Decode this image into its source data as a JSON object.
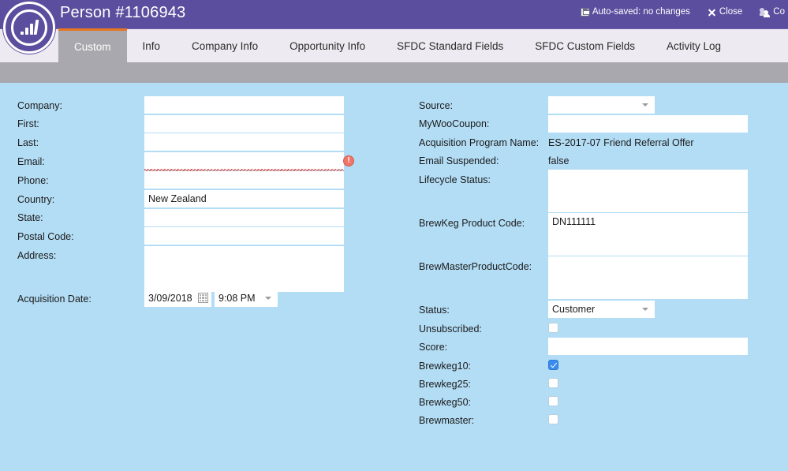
{
  "header": {
    "title": "Person #1106943",
    "logo_name": "marketo-logo",
    "actions": [
      {
        "label": "Auto-saved: no changes",
        "icon": "save-icon"
      },
      {
        "label": "Close",
        "icon": "close-icon"
      },
      {
        "label": "Co",
        "icon": "people-icon"
      }
    ]
  },
  "tabs": [
    {
      "label": "Custom",
      "active": true
    },
    {
      "label": "Info",
      "active": false
    },
    {
      "label": "Company Info",
      "active": false
    },
    {
      "label": "Opportunity Info",
      "active": false
    },
    {
      "label": "SFDC Standard Fields",
      "active": false
    },
    {
      "label": "SFDC Custom Fields",
      "active": false
    },
    {
      "label": "Activity Log",
      "active": false
    }
  ],
  "form": {
    "left": {
      "company_label": "Company:",
      "company_value": "",
      "first_label": "First:",
      "first_value": "",
      "last_label": "Last:",
      "last_value": "",
      "email_label": "Email:",
      "email_value": "",
      "email_error_glyph": "!",
      "phone_label": "Phone:",
      "phone_value": "",
      "country_label": "Country:",
      "country_value": "New Zealand",
      "state_label": "State:",
      "state_value": "",
      "postal_label": "Postal Code:",
      "postal_value": "",
      "address_label": "Address:",
      "address_value": "",
      "acquisition_date_label": "Acquisition Date:",
      "acquisition_date_value": "3/09/2018",
      "acquisition_time_value": "9:08 PM"
    },
    "right": {
      "source_label": "Source:",
      "source_value": "",
      "mywoocoupon_label": "MyWooCoupon:",
      "mywoocoupon_value": "",
      "acq_program_label": "Acquisition Program Name:",
      "acq_program_value": "ES-2017-07 Friend Referral Offer",
      "email_suspended_label": "Email Suspended:",
      "email_suspended_value": "false",
      "lifecycle_label": "Lifecycle Status:",
      "lifecycle_value": "",
      "brewkeg_code_label": "BrewKeg Product Code:",
      "brewkeg_code_value": "DN111111",
      "brewmaster_code_label": "BrewMasterProductCode:",
      "brewmaster_code_value": "",
      "status_label": "Status:",
      "status_value": "Customer",
      "unsubscribed_label": "Unsubscribed:",
      "unsubscribed_checked": false,
      "score_label": "Score:",
      "score_value": "",
      "brewkeg10_label": "Brewkeg10:",
      "brewkeg10_checked": true,
      "brewkeg25_label": "Brewkeg25:",
      "brewkeg25_checked": false,
      "brewkeg50_label": "Brewkeg50:",
      "brewkeg50_checked": false,
      "brewmaster_label": "Brewmaster:",
      "brewmaster_checked": false
    }
  },
  "colors": {
    "header_purple": "#5c4e9e",
    "tab_active_orange": "#e8761f",
    "form_blue": "#b3ddf5",
    "gray_strip": "#a8a8ae",
    "checkbox_checked": "#3b8cf0",
    "error_red": "#f0766a"
  }
}
